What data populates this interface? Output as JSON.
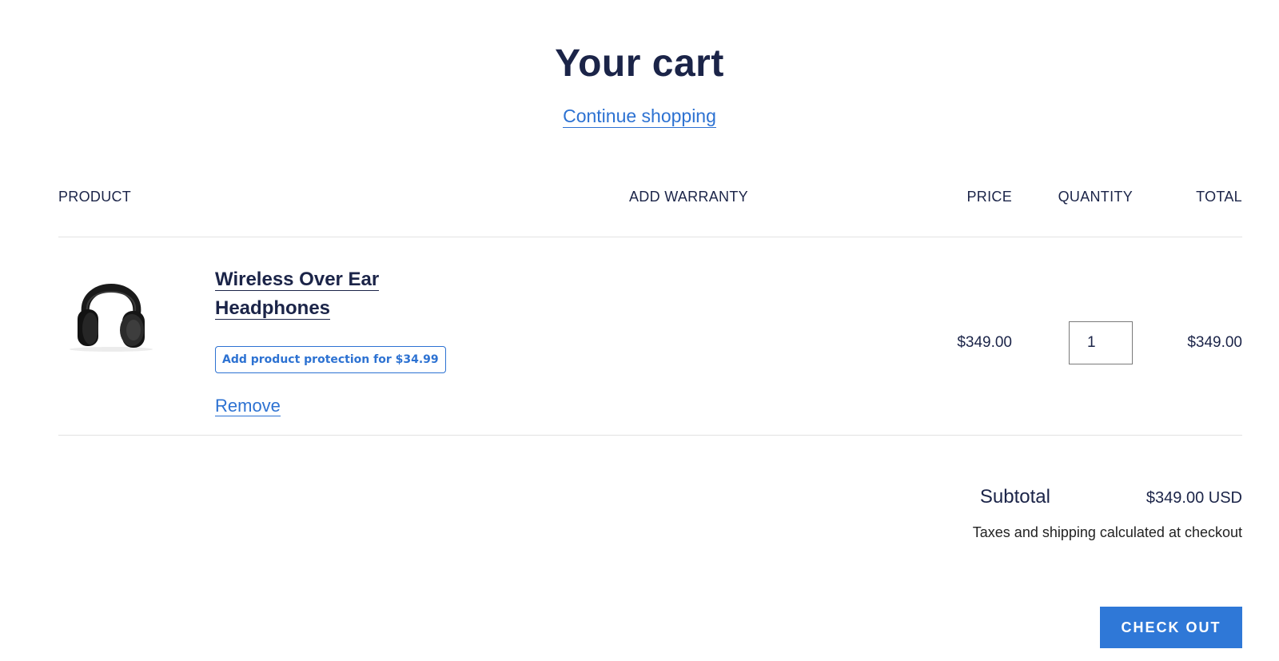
{
  "page": {
    "title": "Your cart",
    "continue_link": "Continue shopping"
  },
  "table": {
    "headers": {
      "product": "PRODUCT",
      "warranty": "ADD WARRANTY",
      "price": "PRICE",
      "quantity": "QUANTITY",
      "total": "TOTAL"
    }
  },
  "items": [
    {
      "name": "Wireless Over Ear Headphones",
      "image_icon": "headphones-image",
      "protection_label": "Add product protection for $34.99",
      "remove_label": "Remove",
      "price": "$349.00",
      "quantity": "1",
      "total": "$349.00"
    }
  ],
  "summary": {
    "subtotal_label": "Subtotal",
    "subtotal_value": "$349.00 USD",
    "tax_note": "Taxes and shipping calculated at checkout",
    "checkout_label": "CHECK OUT"
  },
  "colors": {
    "heading": "#1b2448",
    "link": "#2d72d2",
    "button": "#2f78d7",
    "divider": "#e2e2e2"
  }
}
